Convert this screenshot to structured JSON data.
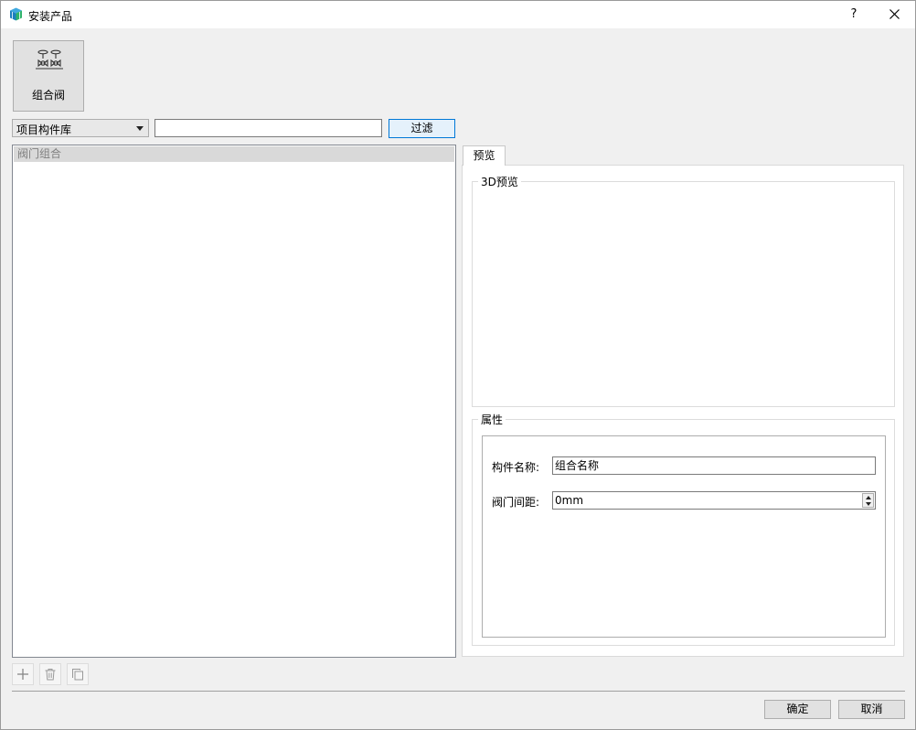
{
  "window": {
    "title": "安装产品",
    "help_label": "?"
  },
  "product": {
    "label": "组合阀"
  },
  "library_select": {
    "selected": "项目构件库"
  },
  "filter": {
    "input_value": "",
    "button_label": "过滤"
  },
  "tree": {
    "items": [
      "阀门组合"
    ]
  },
  "preview_tab": {
    "label": "预览"
  },
  "preview_group": {
    "title": "3D预览"
  },
  "properties": {
    "title": "属性",
    "fields": [
      {
        "label": "构件名称:",
        "value": "组合名称"
      },
      {
        "label": "阀门间距:",
        "value": "0mm"
      }
    ]
  },
  "toolbar": {
    "icons": [
      "plus-icon",
      "trash-icon",
      "copy-icon"
    ]
  },
  "footer": {
    "ok_label": "确定",
    "cancel_label": "取消"
  },
  "colors": {
    "accent": "#0078d7",
    "app_icon": "#2a8fcf"
  }
}
